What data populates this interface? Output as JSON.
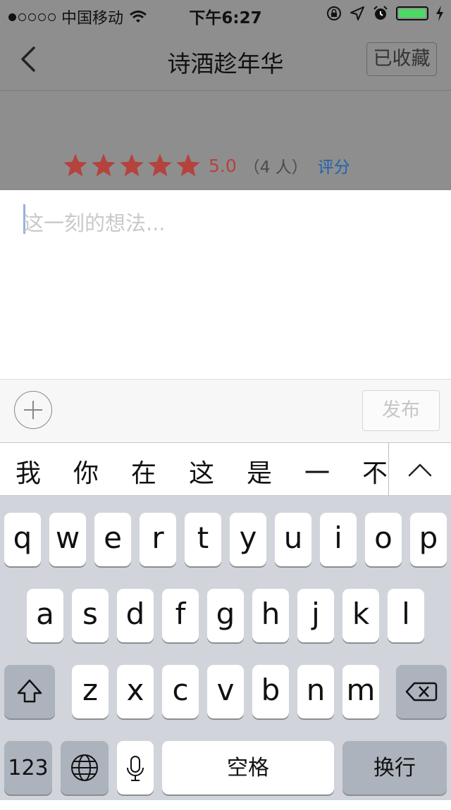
{
  "status_bar": {
    "carrier": "中国移动",
    "time": "下午6:27"
  },
  "nav": {
    "title": "诗酒趁年华",
    "favorite_label": "已收藏"
  },
  "rating": {
    "stars": 5,
    "score": "5.0",
    "people": "（4 人）",
    "rate_link": "评分"
  },
  "composer": {
    "placeholder": "这一刻的想法..."
  },
  "toolbar": {
    "publish_label": "发布"
  },
  "suggestions": [
    "我",
    "你",
    "在",
    "这",
    "是",
    "一",
    "不"
  ],
  "keyboard": {
    "row1": [
      "q",
      "w",
      "e",
      "r",
      "t",
      "y",
      "u",
      "i",
      "o",
      "p"
    ],
    "row2": [
      "a",
      "s",
      "d",
      "f",
      "g",
      "h",
      "j",
      "k",
      "l"
    ],
    "row3": [
      "z",
      "x",
      "c",
      "v",
      "b",
      "n",
      "m"
    ],
    "numbers_key": "123",
    "space_key": "空格",
    "return_key": "换行"
  },
  "colors": {
    "overlay": "#8e8e8e",
    "star": "#b4433d",
    "link": "#1e63ae",
    "battery": "#4cd964",
    "keyboard_bg": "#d1d5db"
  }
}
